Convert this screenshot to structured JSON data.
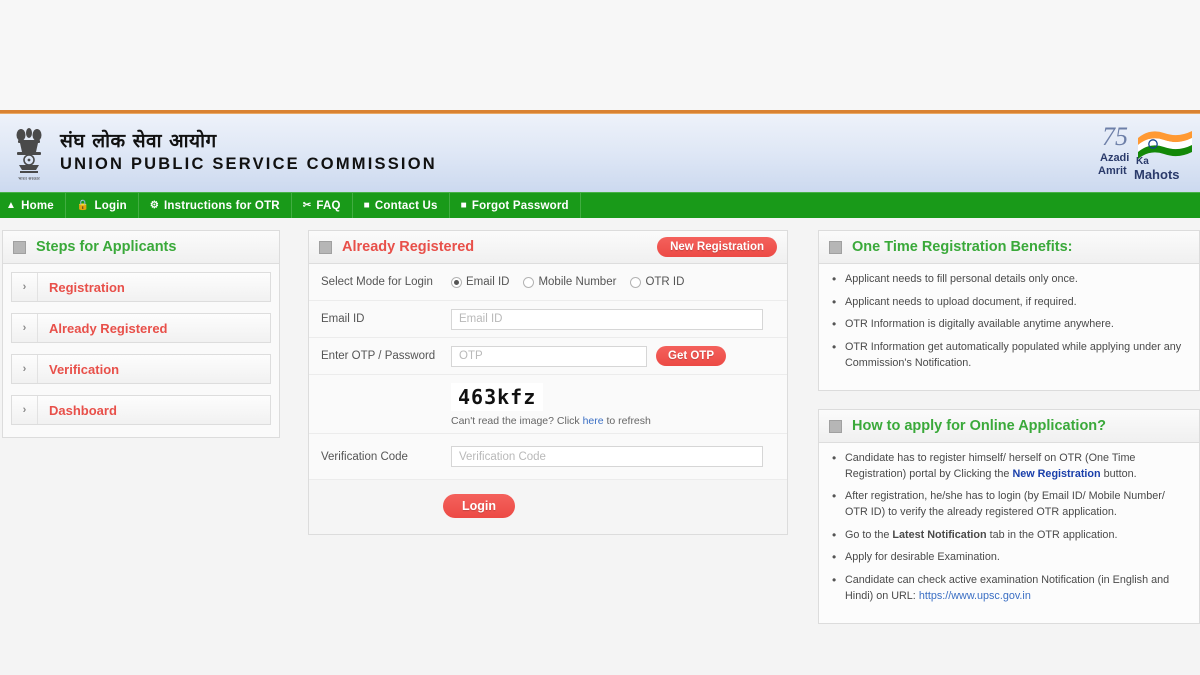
{
  "header": {
    "title_hindi": "संघ लोक सेवा आयोग",
    "title_english": "UNION PUBLIC SERVICE COMMISSION",
    "emblem_icon": "ashoka-lion-capital-emblem",
    "azadi": {
      "number": "75",
      "line1": "Azadi",
      "line2": "Amrit",
      "line3": "Ka",
      "line4": "Mahots"
    }
  },
  "nav": {
    "items": [
      {
        "label": "Home",
        "icon": "home-icon"
      },
      {
        "label": "Login",
        "icon": "lock-icon"
      },
      {
        "label": "Instructions for OTR",
        "icon": "gear-icon"
      },
      {
        "label": "FAQ",
        "icon": "scissors-icon"
      },
      {
        "label": "Contact Us",
        "icon": "square-icon"
      },
      {
        "label": "Forgot Password",
        "icon": "square-icon"
      }
    ]
  },
  "sidebar": {
    "title": "Steps for Applicants",
    "arrow": "›",
    "items": [
      {
        "label": "Registration"
      },
      {
        "label": "Already Registered"
      },
      {
        "label": "Verification"
      },
      {
        "label": "Dashboard"
      }
    ]
  },
  "login_panel": {
    "title": "Already Registered",
    "new_registration_button": "New Registration",
    "mode_label": "Select Mode for Login",
    "modes": [
      {
        "label": "Email ID",
        "selected": true
      },
      {
        "label": "Mobile Number",
        "selected": false
      },
      {
        "label": "OTR ID",
        "selected": false
      }
    ],
    "email_label": "Email ID",
    "email_value": "",
    "email_placeholder": "Email ID",
    "otp_label": "Enter OTP / Password",
    "otp_value": "",
    "otp_placeholder": "OTP",
    "get_otp_button": "Get OTP",
    "captcha_text": "463kfz",
    "captcha_hint_pre": "Can't read the image? Click ",
    "captcha_hint_link": "here",
    "captcha_hint_post": " to refresh",
    "verification_label": "Verification Code",
    "verification_value": "",
    "verification_placeholder": "Verification Code",
    "login_button": "Login"
  },
  "benefits_panel": {
    "title": "One Time Registration Benefits:",
    "items": [
      "Applicant needs to fill personal details only once.",
      "Applicant needs to upload document, if required.",
      "OTR Information is digitally available anytime anywhere.",
      "OTR Information get automatically populated while applying under any Commission's Notification."
    ]
  },
  "howto_panel": {
    "title": "How to apply for Online Application?",
    "items": [
      {
        "pre": "Candidate has to register himself/ herself on OTR (One Time Registration) portal by Clicking the ",
        "strong": "New Registration",
        "post": " button."
      },
      {
        "pre": "After registration, he/she has to login (by Email ID/ Mobile Number/ OTR ID) to verify the already registered OTR application.",
        "strong": "",
        "post": ""
      },
      {
        "pre": "Go to the ",
        "strong": "Latest Notification",
        "post": " tab in the OTR application."
      },
      {
        "pre": "Apply for desirable Examination.",
        "strong": "",
        "post": ""
      },
      {
        "pre": "Candidate can check active examination Notification (in English and Hindi) on URL: ",
        "strong": "",
        "post": "",
        "link": "https://www.upsc.gov.in"
      }
    ]
  },
  "colors": {
    "nav_green": "#199a19",
    "accent_red": "#e8504a",
    "title_green": "#3aa93a",
    "orange_rule": "#d98232",
    "link_blue": "#3b6fc4"
  }
}
